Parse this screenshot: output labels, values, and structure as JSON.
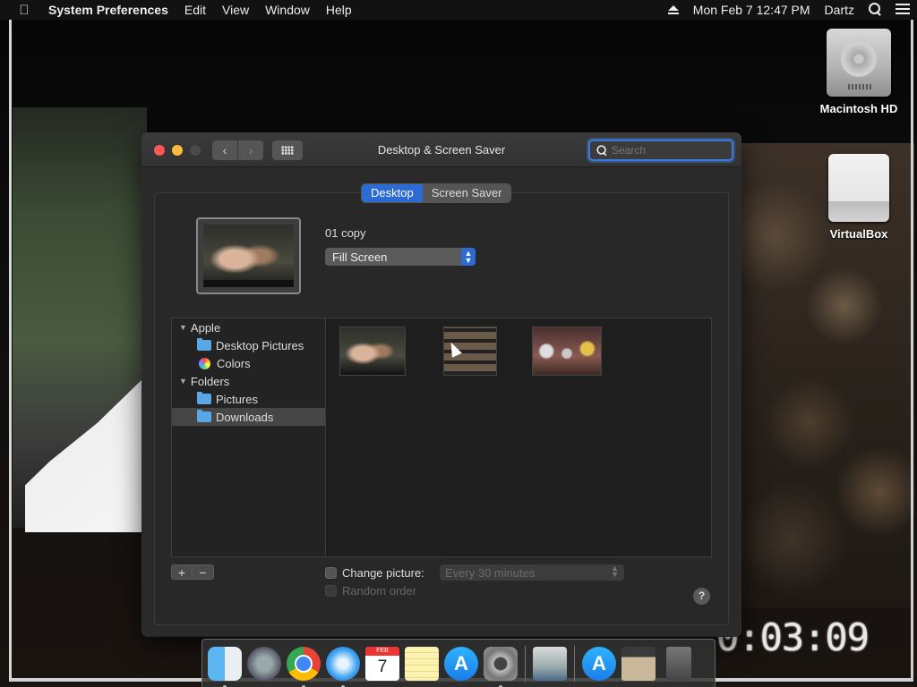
{
  "menubar": {
    "apple_icon": "apple-logo-icon",
    "app_name": "System Preferences",
    "menus": [
      "Edit",
      "View",
      "Window",
      "Help"
    ],
    "clock": "Mon Feb 7  12:47 PM",
    "user": "Dartz"
  },
  "desktop": {
    "icons": [
      {
        "label": "Macintosh HD",
        "icon": "hard-drive-icon"
      },
      {
        "label": "VirtualBox",
        "icon": "external-drive-icon"
      }
    ],
    "wallpaper_timecode": "0:03:09"
  },
  "window": {
    "title": "Desktop & Screen Saver",
    "search_placeholder": "Search",
    "tabs": [
      {
        "label": "Desktop",
        "active": true
      },
      {
        "label": "Screen Saver",
        "active": false
      }
    ],
    "current_picture_name": "01 copy",
    "fit_option": "Fill Screen",
    "sources": {
      "groups": [
        {
          "label": "Apple",
          "items": [
            {
              "label": "Desktop Pictures",
              "icon": "folder-icon"
            },
            {
              "label": "Colors",
              "icon": "colors-icon"
            }
          ]
        },
        {
          "label": "Folders",
          "items": [
            {
              "label": "Pictures",
              "icon": "folder-icon"
            },
            {
              "label": "Downloads",
              "icon": "folder-icon",
              "selected": true
            }
          ]
        }
      ]
    },
    "add_label": "+",
    "remove_label": "−",
    "change_picture_label": "Change picture:",
    "change_interval": "Every 30 minutes",
    "random_order_label": "Random order",
    "help_label": "?"
  },
  "dock": {
    "apps": [
      "Finder",
      "Launchpad",
      "Google Chrome",
      "Safari",
      "Calendar",
      "Notes",
      "App Store",
      "System Preferences",
      "Preview",
      "App Store",
      "Downloads",
      "Trash"
    ],
    "calendar_month": "FEB",
    "calendar_day": "7"
  },
  "colors": {
    "accent": "#2c6bd4",
    "close": "#fc5753",
    "minimize": "#fdbc40",
    "window_bg": "#2a2a2a"
  }
}
